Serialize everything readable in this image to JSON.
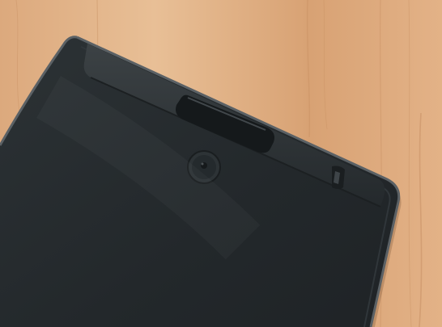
{
  "scene": {
    "subject": "tablet-back-panel",
    "surface": "wood-table",
    "colors": {
      "wood_light": "#e7bd94",
      "wood_mid": "#d9a77c",
      "wood_dark": "#c98f63",
      "device_body": "#262b2e",
      "device_edge": "#53595d",
      "device_highlight": "#3a4043",
      "slot": "#1c2022",
      "button": "#2c3134"
    }
  }
}
